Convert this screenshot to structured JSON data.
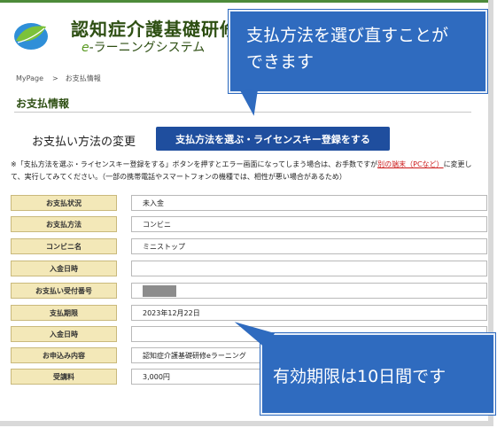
{
  "header": {
    "title": "認知症介護基礎研修",
    "subtitle_e": "e",
    "subtitle_rest": "-ラーニングシステム"
  },
  "breadcrumb": {
    "home": "MyPage",
    "separator": ">",
    "current": "お支払情報"
  },
  "page_title": "お支払情報",
  "payment_change": {
    "label": "お支払い方法の変更",
    "button_label": "支払方法を選ぶ・ライセンスキー登録をする"
  },
  "note": {
    "part1": "※「支払方法を選ぶ・ライセンスキー登録をする」ボタンを押すとエラー画面になってしまう場合は、お手数ですが",
    "red": "別の端末（PCなど）",
    "part2": "に変更して、実行してみてください。（一部の携帯電話やスマートフォンの機種では、相性が悪い場合があるため）"
  },
  "table": {
    "rows": [
      {
        "label": "お支払状況",
        "value": "未入金"
      },
      {
        "label": "お支払方法",
        "value": "コンビニ"
      },
      {
        "label": "コンビニ名",
        "value": "ミニストップ"
      },
      {
        "label": "入金日時",
        "value": ""
      },
      {
        "label": "お支払い受付番号",
        "value": ""
      },
      {
        "label": "支払期限",
        "value": "2023年12月22日"
      },
      {
        "label": "入金日時",
        "value": ""
      },
      {
        "label": "お申込み内容",
        "value": "認知症介護基礎研修eラーニング"
      },
      {
        "label": "受講料",
        "value": "3,000円"
      }
    ]
  },
  "callouts": {
    "top_line1": "支払方法を選び直すことが",
    "top_line2": "できます",
    "bottom": "有効期限は10日間です"
  },
  "colors": {
    "brand_green": "#2e4f13",
    "button_blue": "#1f4e9e",
    "callout_blue": "#2f6bbf",
    "label_bg": "#f3e8b8"
  }
}
